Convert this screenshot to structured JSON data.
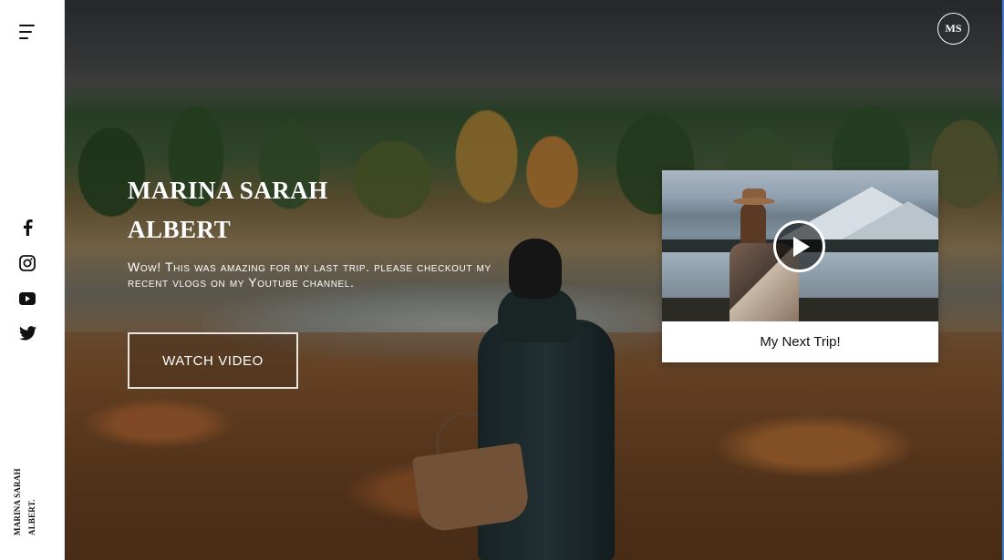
{
  "sidebar": {
    "menu_icon": "hamburger-menu-icon",
    "social": [
      {
        "name": "facebook",
        "icon": "facebook-icon"
      },
      {
        "name": "instagram",
        "icon": "instagram-icon"
      },
      {
        "name": "youtube",
        "icon": "youtube-icon"
      },
      {
        "name": "twitter",
        "icon": "twitter-icon"
      }
    ],
    "vertical_name_line1": "MARINA SARAH",
    "vertical_name_line2": "ALBERT."
  },
  "header": {
    "badge_initials": "MS"
  },
  "hero": {
    "title_line1": "MARINA SARAH",
    "title_line2": "ALBERT",
    "subtitle": "Wow! This was amazing for my last trip. please checkout my recent vlogs on my Youtube channel.",
    "button_label": "WATCH VIDEO"
  },
  "video_card": {
    "caption": "My Next Trip!",
    "play_icon": "play-icon"
  },
  "colors": {
    "text_on_image": "#ffffff",
    "sidebar_bg": "#ffffff",
    "edge_accent": "#3b79c9"
  }
}
